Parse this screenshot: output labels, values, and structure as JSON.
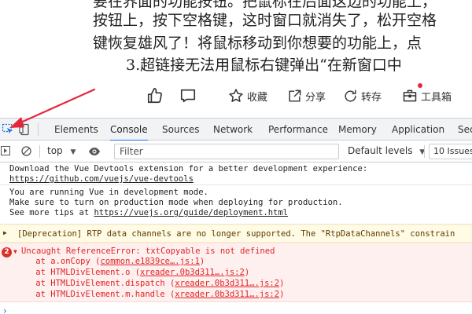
{
  "article": {
    "line0": "要在界面的功能按钮。把鼠标在后面这边的功能上，",
    "line1": "按钮上，按下空格键，这时窗口就消失了，松开空格",
    "line2": "键恢复雄风了！将鼠标移动到你想要的功能上，点",
    "line3": "3.超链接无法用鼠标右键弹出“在新窗口中"
  },
  "actions": {
    "favorite": "收藏",
    "share": "分享",
    "repost": "转存",
    "toolbox": "工具箱"
  },
  "devtools": {
    "tabs": [
      {
        "label": "Elements"
      },
      {
        "label": "Console"
      },
      {
        "label": "Sources"
      },
      {
        "label": "Network"
      },
      {
        "label": "Performance"
      },
      {
        "label": "Memory"
      },
      {
        "label": "Application"
      },
      {
        "label": "Sec"
      }
    ],
    "active_tab": "Console",
    "context": "top",
    "filter_placeholder": "Filter",
    "levels": "Default levels",
    "issues": "10 Issues:"
  },
  "console": {
    "vue_devtools_line1": "Download the Vue Devtools extension for a better development experience:",
    "vue_devtools_link": "https://github.com/vuejs/vue-devtools",
    "dev_mode_line1": "You are running Vue in development mode.",
    "dev_mode_line2": "Make sure to turn on production mode when deploying for production.",
    "dev_mode_line3_prefix": "See more tips at ",
    "dev_mode_link": "https://vuejs.org/guide/deployment.html",
    "warning": "[Deprecation] RTP data channels are no longer supported. The \"RtpDataChannels\" constrain",
    "error_count": "2",
    "error_title": "Uncaught ReferenceError: txtCopyable is not defined",
    "stack": [
      {
        "prefix": "    at a.onCopy (",
        "link": "common.e1839ce….js:1",
        "suffix": ")"
      },
      {
        "prefix": "    at HTMLDivElement.o (",
        "link": "xreader.0b3d311….js:2",
        "suffix": ")"
      },
      {
        "prefix": "    at HTMLDivElement.dispatch (",
        "link": "xreader.0b3d311….js:2",
        "suffix": ")"
      },
      {
        "prefix": "    at HTMLDivElement.m.handle (",
        "link": "xreader.0b3d311….js:2",
        "suffix": ")"
      }
    ]
  },
  "colors": {
    "accent": "#1a73e8",
    "error": "#e02424",
    "annotation": "#e5273c"
  }
}
